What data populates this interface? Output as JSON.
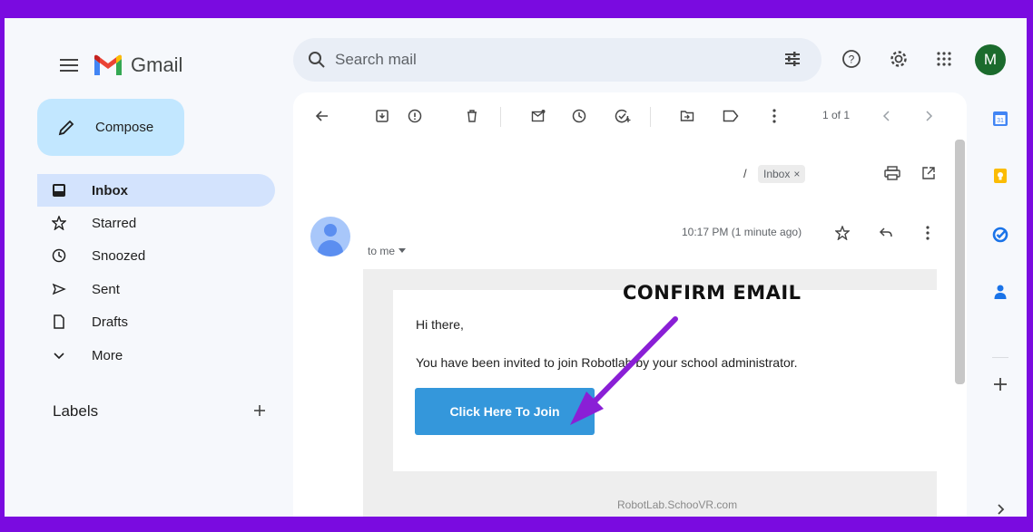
{
  "app": {
    "name": "Gmail"
  },
  "user": {
    "initial": "M"
  },
  "search": {
    "placeholder": "Search mail"
  },
  "compose": {
    "label": "Compose"
  },
  "nav": [
    {
      "label": "Inbox",
      "icon": "inbox-icon",
      "active": true
    },
    {
      "label": "Starred",
      "icon": "star-icon"
    },
    {
      "label": "Snoozed",
      "icon": "clock-icon"
    },
    {
      "label": "Sent",
      "icon": "send-icon"
    },
    {
      "label": "Drafts",
      "icon": "draft-icon"
    },
    {
      "label": "More",
      "icon": "chevron-down-icon"
    }
  ],
  "labels": {
    "title": "Labels"
  },
  "toolbar": {
    "pager": "1 of 1"
  },
  "message": {
    "subject_prefix": "/",
    "label_chip": "Inbox",
    "recipient": "to me",
    "time": "10:17 PM (1 minute ago)",
    "greeting": "Hi there,",
    "body": "You have been invited to join Robotlab by your school administrator.",
    "button": "Click Here To Join",
    "footer": "RobotLab.SchooVR.com"
  },
  "annotation": {
    "text": "CONFIRM EMAIL",
    "color": "#8a1fd6"
  },
  "colors": {
    "background": "#7a0be0",
    "compose": "#c2e7ff",
    "active_nav": "#d3e3fd",
    "join_button": "#3497db"
  }
}
